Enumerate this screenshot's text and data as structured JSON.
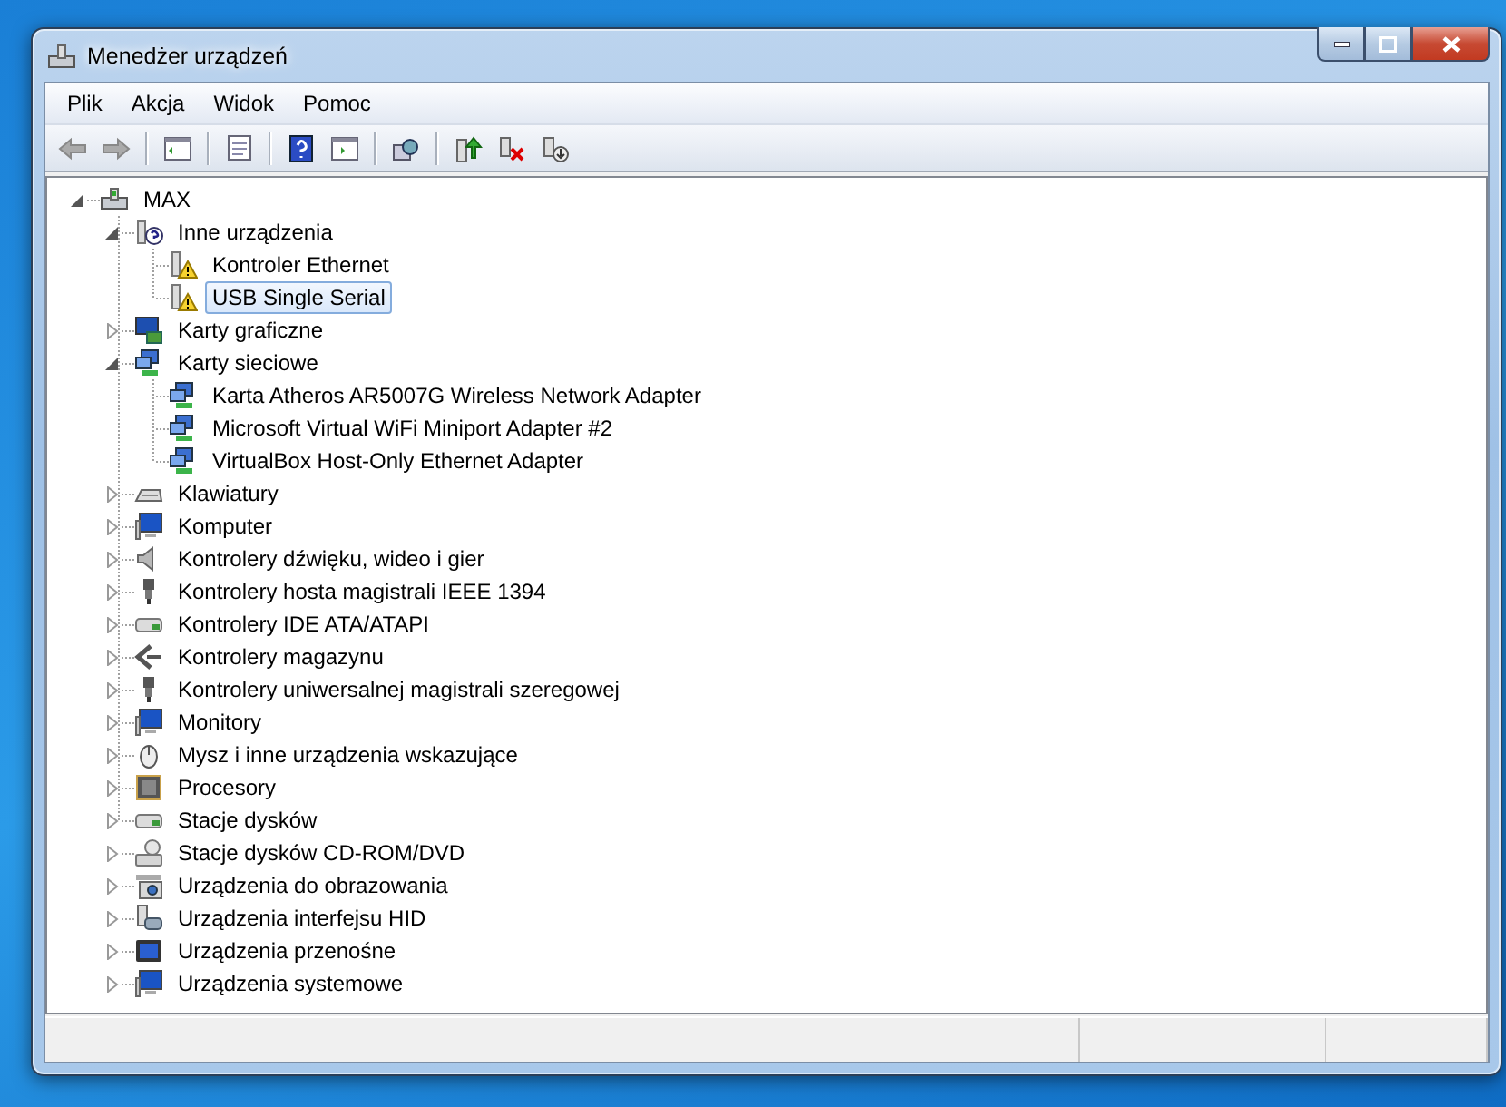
{
  "window": {
    "title": "Menedżer urządzeń"
  },
  "menu": [
    "Plik",
    "Akcja",
    "Widok",
    "Pomoc"
  ],
  "tree": {
    "label": "MAX",
    "kind": "computer",
    "expanded": true,
    "selected": false,
    "children": [
      {
        "label": "Inne urządzenia",
        "kind": "unknown",
        "expanded": true,
        "selected": false,
        "children": [
          {
            "label": "Kontroler Ethernet",
            "kind": "warning",
            "selected": false
          },
          {
            "label": "USB Single Serial",
            "kind": "warning",
            "selected": true
          }
        ]
      },
      {
        "label": "Karty graficzne",
        "kind": "display",
        "expanded": false,
        "selected": false
      },
      {
        "label": "Karty sieciowe",
        "kind": "network",
        "expanded": true,
        "selected": false,
        "children": [
          {
            "label": "Karta Atheros AR5007G Wireless Network Adapter",
            "kind": "network",
            "selected": false
          },
          {
            "label": "Microsoft Virtual WiFi Miniport Adapter #2",
            "kind": "network",
            "selected": false
          },
          {
            "label": "VirtualBox Host-Only Ethernet Adapter",
            "kind": "network",
            "selected": false
          }
        ]
      },
      {
        "label": "Klawiatury",
        "kind": "keyboard",
        "expanded": false,
        "selected": false
      },
      {
        "label": "Komputer",
        "kind": "monitor",
        "expanded": false,
        "selected": false
      },
      {
        "label": "Kontrolery dźwięku, wideo i gier",
        "kind": "speaker",
        "expanded": false,
        "selected": false
      },
      {
        "label": "Kontrolery hosta magistrali IEEE 1394",
        "kind": "plug",
        "expanded": false,
        "selected": false
      },
      {
        "label": "Kontrolery IDE ATA/ATAPI",
        "kind": "drive",
        "expanded": false,
        "selected": false
      },
      {
        "label": "Kontrolery magazynu",
        "kind": "storage",
        "expanded": false,
        "selected": false
      },
      {
        "label": "Kontrolery uniwersalnej magistrali szeregowej",
        "kind": "plug",
        "expanded": false,
        "selected": false
      },
      {
        "label": "Monitory",
        "kind": "monitor",
        "expanded": false,
        "selected": false
      },
      {
        "label": "Mysz i inne urządzenia wskazujące",
        "kind": "mouse",
        "expanded": false,
        "selected": false
      },
      {
        "label": "Procesory",
        "kind": "chip",
        "expanded": false,
        "selected": false
      },
      {
        "label": "Stacje dysków",
        "kind": "drive",
        "expanded": false,
        "selected": false
      },
      {
        "label": "Stacje dysków CD-ROM/DVD",
        "kind": "disc",
        "expanded": false,
        "selected": false
      },
      {
        "label": "Urządzenia do obrazowania",
        "kind": "camera",
        "expanded": false,
        "selected": false
      },
      {
        "label": "Urządzenia interfejsu HID",
        "kind": "hid",
        "expanded": false,
        "selected": false
      },
      {
        "label": "Urządzenia przenośne",
        "kind": "portable",
        "expanded": false,
        "selected": false
      },
      {
        "label": "Urządzenia systemowe",
        "kind": "monitor",
        "expanded": false,
        "selected": false
      }
    ]
  }
}
